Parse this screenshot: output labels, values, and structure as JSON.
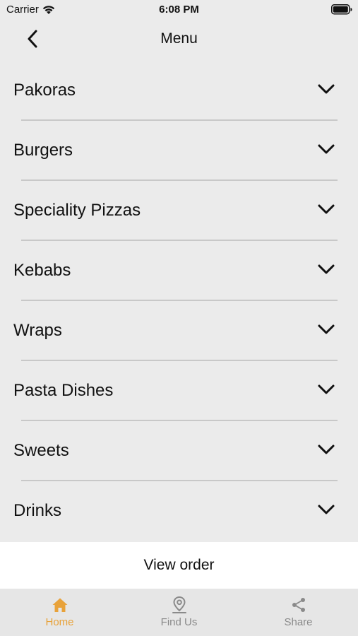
{
  "status_bar": {
    "carrier": "Carrier",
    "time": "6:08 PM"
  },
  "nav": {
    "title": "Menu"
  },
  "menu": {
    "items": [
      {
        "label": "Pakoras"
      },
      {
        "label": "Burgers"
      },
      {
        "label": "Speciality Pizzas"
      },
      {
        "label": "Kebabs"
      },
      {
        "label": "Wraps"
      },
      {
        "label": "Pasta Dishes"
      },
      {
        "label": "Sweets"
      },
      {
        "label": "Drinks"
      }
    ]
  },
  "view_order": {
    "label": "View order"
  },
  "tab_bar": {
    "tabs": [
      {
        "label": "Home",
        "icon": "home-icon",
        "active": true
      },
      {
        "label": "Find Us",
        "icon": "map-pin-icon",
        "active": false
      },
      {
        "label": "Share",
        "icon": "share-icon",
        "active": false
      }
    ]
  },
  "colors": {
    "accent": "#e8a23a",
    "inactive": "#8a8a8a",
    "background": "#ebebeb"
  }
}
